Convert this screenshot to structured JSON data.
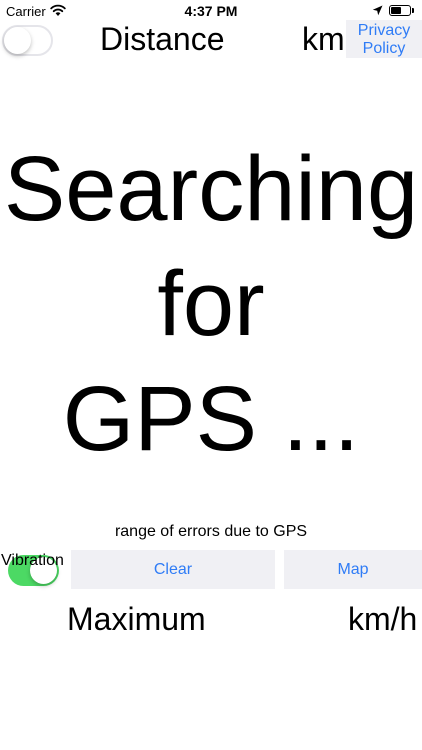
{
  "status_bar": {
    "carrier": "Carrier",
    "time": "4:37 PM",
    "battery_level": 0.55,
    "icons": [
      "wifi-icon",
      "location-arrow-icon",
      "battery-icon"
    ]
  },
  "header": {
    "distance_toggle_on": false,
    "distance_label": "Distance",
    "distance_unit": "km",
    "privacy_label": "Privacy\nPolicy"
  },
  "main": {
    "status_text": "Searching\nfor\nGPS ...",
    "gps_note": "range of errors due to GPS"
  },
  "controls": {
    "vibration_label": "Vibration",
    "vibration_on": true,
    "clear_label": "Clear",
    "map_label": "Map"
  },
  "footer": {
    "max_label": "Maximum",
    "speed_unit": "km/h"
  },
  "colors": {
    "accent": "#2f7cf6",
    "toggle_on": "#4cd964",
    "button_bg": "#f0f0f4"
  }
}
